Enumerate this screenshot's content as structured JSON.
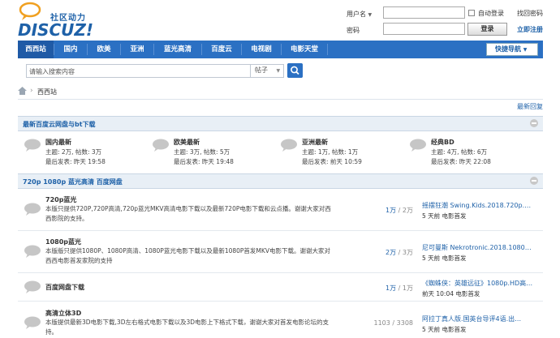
{
  "header": {
    "logo_cn": "社区动力",
    "logo_en": "DISCUZ!",
    "username_label": "用户名",
    "password_label": "密码",
    "auto_login": "自动登录",
    "forgot_password": "找回密码",
    "login_button": "登录",
    "register": "立即注册"
  },
  "nav": {
    "items": [
      "西西站",
      "国内",
      "欧美",
      "亚洲",
      "蓝光高清",
      "百度云",
      "电视剧",
      "电影天堂"
    ],
    "quick_nav": "快捷导航"
  },
  "search": {
    "placeholder": "请输入搜索内容",
    "category": "帖子"
  },
  "breadcrumb": {
    "current": "西西站"
  },
  "latest_reply": "最新回复",
  "section1": {
    "title": "最新百度云网盘与bt下载",
    "forums": [
      {
        "name": "国内最新",
        "stats": "主题: 2万, 帖数: 3万",
        "last": "最后发表: 昨天 19:58"
      },
      {
        "name": "欧美最新",
        "stats": "主题: 3万, 帖数: 5万",
        "last": "最后发表: 昨天 19:48"
      },
      {
        "name": "亚洲最新",
        "stats": "主题: 1万, 帖数: 1万",
        "last": "最后发表: 前天 10:59"
      },
      {
        "name": "经典BD",
        "stats": "主题: 4万, 帖数: 6万",
        "last": "最后发表: 昨天 22:08"
      }
    ]
  },
  "section2": {
    "title": "720p 1080p 蓝光高清 百度网盘",
    "forums": [
      {
        "name": "720p蓝光",
        "desc": "本版只提供720P,720P高清,720p蓝光MKV高清电影下载以及最新720P电影下载和云点播。谢谢大家对西西影院的支持。",
        "topics": "1万",
        "posts": "2万",
        "last_title": "摇摆狂潮 Swing.Kids.2018.720p.…",
        "last_meta": "5 天前 电影首发"
      },
      {
        "name": "1080p蓝光",
        "desc": "本版版只提供1080P、1080P高清、1080P蓝光电影下载以及最新1080P首发MKV电影下载。谢谢大家对西西电影首发家院的支持",
        "topics": "2万",
        "posts": "3万",
        "last_title": "尼可曼斯 Nekrotronic.2018.1080…",
        "last_meta": "5 天前 电影首发"
      },
      {
        "name": "百度网盘下载",
        "desc": "",
        "topics": "1万",
        "posts": "1万",
        "last_title": "《蜘蛛侠：英雄远征》1080p.HD高…",
        "last_meta": "前天 10:04 电影首发"
      },
      {
        "name": "高清立体3D",
        "desc": "本版提供最新3D电影下载,3D左右格式电影下载以及3D电影上下格式下载，谢谢大家对首发电影论坛的支持。",
        "topics": "1103",
        "posts": "3308",
        "last_title": "阿拉丁真人版.国英台导评4语.出…",
        "last_meta": "5 天前 电影首发"
      }
    ]
  },
  "colors": {
    "brand": "#1e61a8",
    "nav": "#2b70c3",
    "section_bg": "#e8eff6"
  }
}
